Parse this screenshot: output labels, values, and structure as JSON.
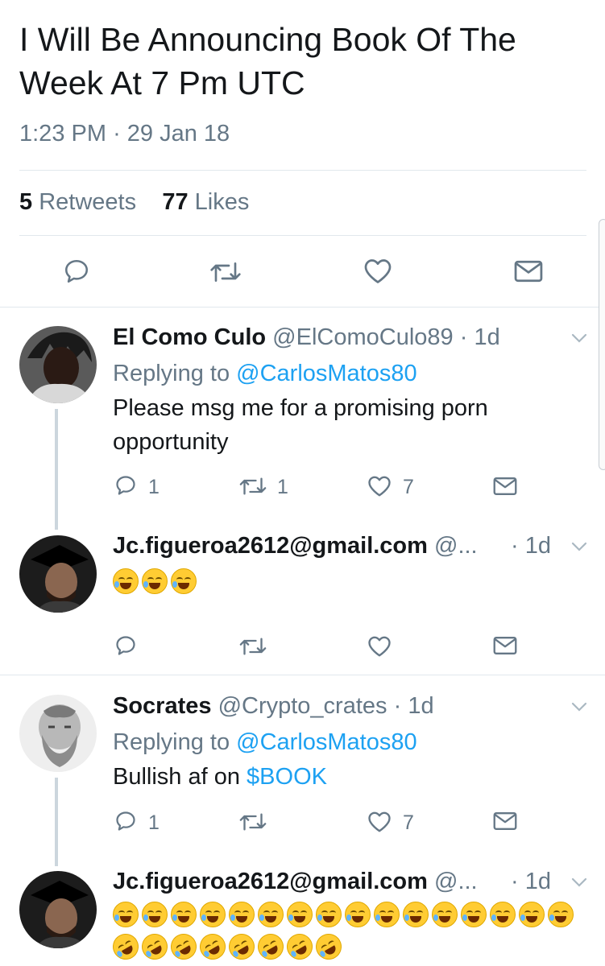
{
  "tweet": {
    "text": "I Will Be Announcing Book Of The Week At 7 Pm UTC",
    "time": "1:23 PM",
    "separator": "·",
    "date": "29 Jan 18",
    "retweet_count": "5",
    "retweet_label": "Retweets",
    "like_count": "77",
    "like_label": "Likes"
  },
  "colors": {
    "link": "#1da1f2",
    "muted": "#657786",
    "divider": "#e1e8ed",
    "thread": "#ccd6dd"
  },
  "icons": [
    "reply-icon",
    "retweet-icon",
    "like-icon",
    "dm-icon",
    "chevron-down-icon"
  ],
  "replies": [
    {
      "name": "El Como Culo",
      "handle": "@ElComoCulo89",
      "dot": " · ",
      "time": "1d",
      "replying_prefix": "Replying to ",
      "replying_to": "@CarlosMatos80",
      "text": "Please msg me for a promising porn opportunity",
      "reply_count": "1",
      "retweet_count": "1",
      "like_count": "7"
    },
    {
      "name": "Jc.figueroa2612@gmail.com",
      "handle": "@...",
      "dot": "·",
      "time": "1d",
      "emoji_text": "😂😂😂"
    },
    {
      "name": "Socrates",
      "handle": "@Crypto_crates",
      "dot": " · ",
      "time": "1d",
      "replying_prefix": "Replying to ",
      "replying_to": "@CarlosMatos80",
      "text_prefix": "Bullish af on ",
      "cashtag": "$BOOK",
      "reply_count": "1",
      "like_count": "7"
    },
    {
      "name": "Jc.figueroa2612@gmail.com",
      "handle": "@...",
      "dot": "·",
      "time": "1d",
      "emoji_text": "😂😂😂😂😂😂😂😂😂😂😂😂😂😂😂😂🤣🤣🤣🤣🤣🤣🤣🤣"
    }
  ]
}
